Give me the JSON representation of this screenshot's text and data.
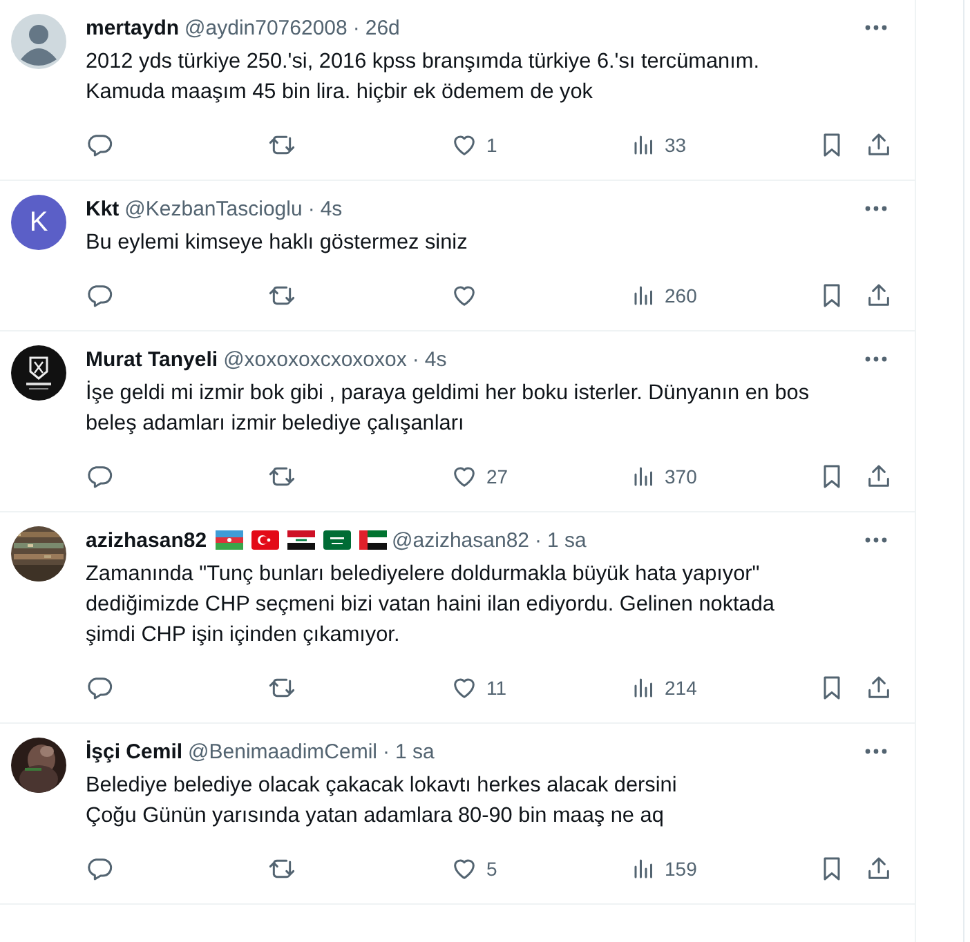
{
  "tweets": [
    {
      "avatar": {
        "kind": "default"
      },
      "name": "mertaydn",
      "handle": "@aydin70762008",
      "separator": "·",
      "time": "26d",
      "text": [
        "2012 yds türkiye 250.'si, 2016 kpss branşımda türkiye 6.'sı tercümanım.",
        "Kamuda maaşım 45 bin lira. hiçbir ek ödemem de yok"
      ],
      "likes": "1",
      "views": "33"
    },
    {
      "avatar": {
        "kind": "letter",
        "letter": "K",
        "color": "#5b5fc7"
      },
      "name": "Kkt",
      "handle": "@KezbanTascioglu",
      "separator": "·",
      "time": "4s",
      "text": [
        "Bu eylemi kimseye haklı göstermez siniz"
      ],
      "views": "260"
    },
    {
      "avatar": {
        "kind": "logo"
      },
      "name": "Murat Tanyeli",
      "handle": "@xoxoxoxcxoxoxox",
      "separator": "·",
      "time": "4s",
      "text": [
        "İşe geldi mi izmir bok gibi , paraya geldimi her boku isterler. Dünyanın en bos",
        "beleş adamları izmir belediye çalışanları"
      ],
      "likes": "27",
      "views": "370"
    },
    {
      "avatar": {
        "kind": "picture"
      },
      "name": "azizhasan82",
      "handle": "@azizhasan82",
      "separator": "·",
      "time": "1 sa",
      "flags": [
        {
          "kind": "az"
        },
        {
          "kind": "tr"
        },
        {
          "kind": "iq"
        },
        {
          "kind": "sa"
        },
        {
          "kind": "ae"
        }
      ],
      "text": [
        "Zamanında \"Tunç bunları belediyelere doldurmakla büyük hata yapıyor\"",
        "dediğimizde CHP seçmeni bizi vatan haini ilan ediyordu. Gelinen noktada",
        "şimdi CHP işin içinden çıkamıyor."
      ],
      "likes": "11",
      "views": "214"
    },
    {
      "avatar": {
        "kind": "picture"
      },
      "name": "İşçi Cemil",
      "handle": "@BenimaadimCemil",
      "separator": "·",
      "time": "1 sa",
      "text": [
        "Belediye belediye olacak çakacak lokavtı herkes alacak dersini",
        "Çoğu Günün yarısında yatan adamlara 80-90 bin maaş ne aq"
      ],
      "likes": "5",
      "views": "159"
    }
  ]
}
